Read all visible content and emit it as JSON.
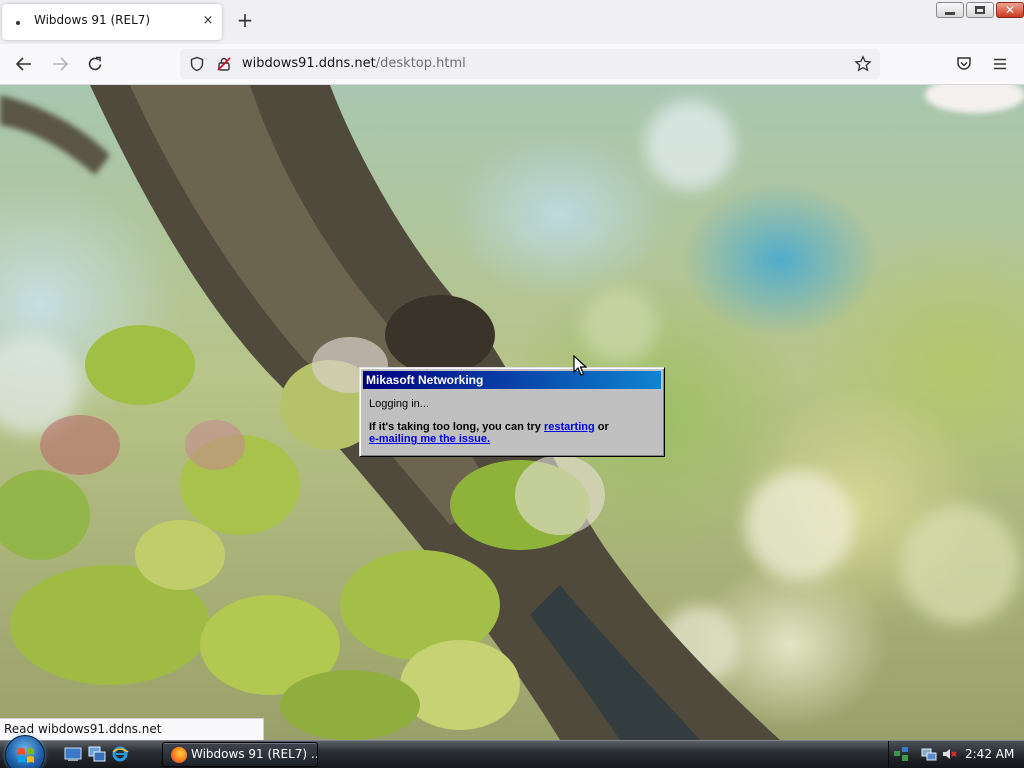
{
  "browser": {
    "tab_title": "Wibdows 91 (REL7)",
    "tab_close": "×",
    "new_tab": "+",
    "url_host": "wibdows91.ddns.net",
    "url_path": "/desktop.html",
    "status_link": "Read wibdows91.ddns.net"
  },
  "dialog": {
    "title": "Mikasoft Networking",
    "status": "Logging in...",
    "message_prefix": "If it's taking too long, you can try ",
    "link_restart": "restarting",
    "message_mid": " or",
    "link_email": "e-mailing me the issue."
  },
  "taskbar": {
    "task_label": "Wibdows 91 (REL7) ...",
    "clock": "2:42 AM"
  },
  "colors": {
    "dialog_title_start": "#000080",
    "dialog_title_end": "#1084d0",
    "link": "#0000ee"
  }
}
